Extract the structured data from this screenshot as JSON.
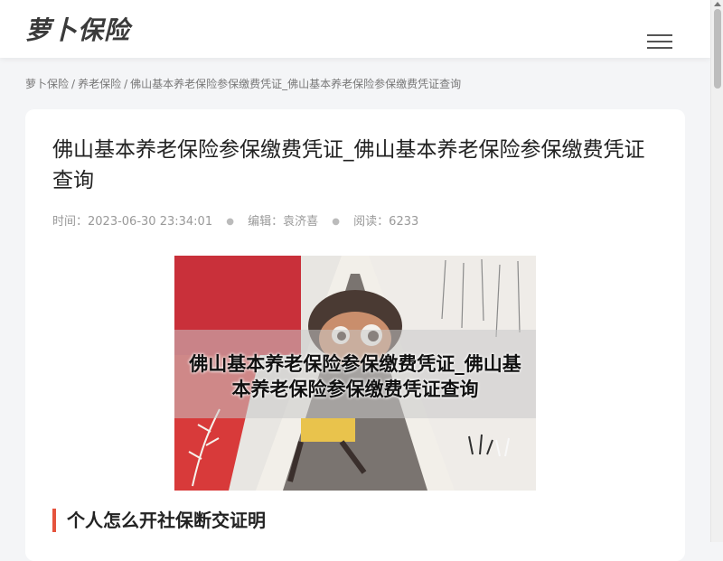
{
  "site": {
    "logo": "萝卜保险"
  },
  "header": {
    "menu_icon": "hamburger-icon"
  },
  "breadcrumb": {
    "items": [
      "萝卜保险",
      "养老保险",
      "佛山基本养老保险参保缴费凭证_佛山基本养老保险参保缴费凭证查询"
    ],
    "separator": "/"
  },
  "article": {
    "title": "佛山基本养老保险参保缴费凭证_佛山基本养老保险参保缴费凭证查询",
    "meta": {
      "time_label": "时间：",
      "time": "2023-06-30 23:34:01",
      "editor_label": "编辑：",
      "editor": "袁济喜",
      "views_label": "阅读：",
      "views": "6233"
    },
    "image_caption": "佛山基本养老保险参保缴费凭证_佛山基本养老保险参保缴费凭证查询",
    "section_heading": "个人怎么开社保断交证明"
  },
  "colors": {
    "accent": "#e5533d",
    "background": "#f4f5f7",
    "card": "#ffffff"
  }
}
